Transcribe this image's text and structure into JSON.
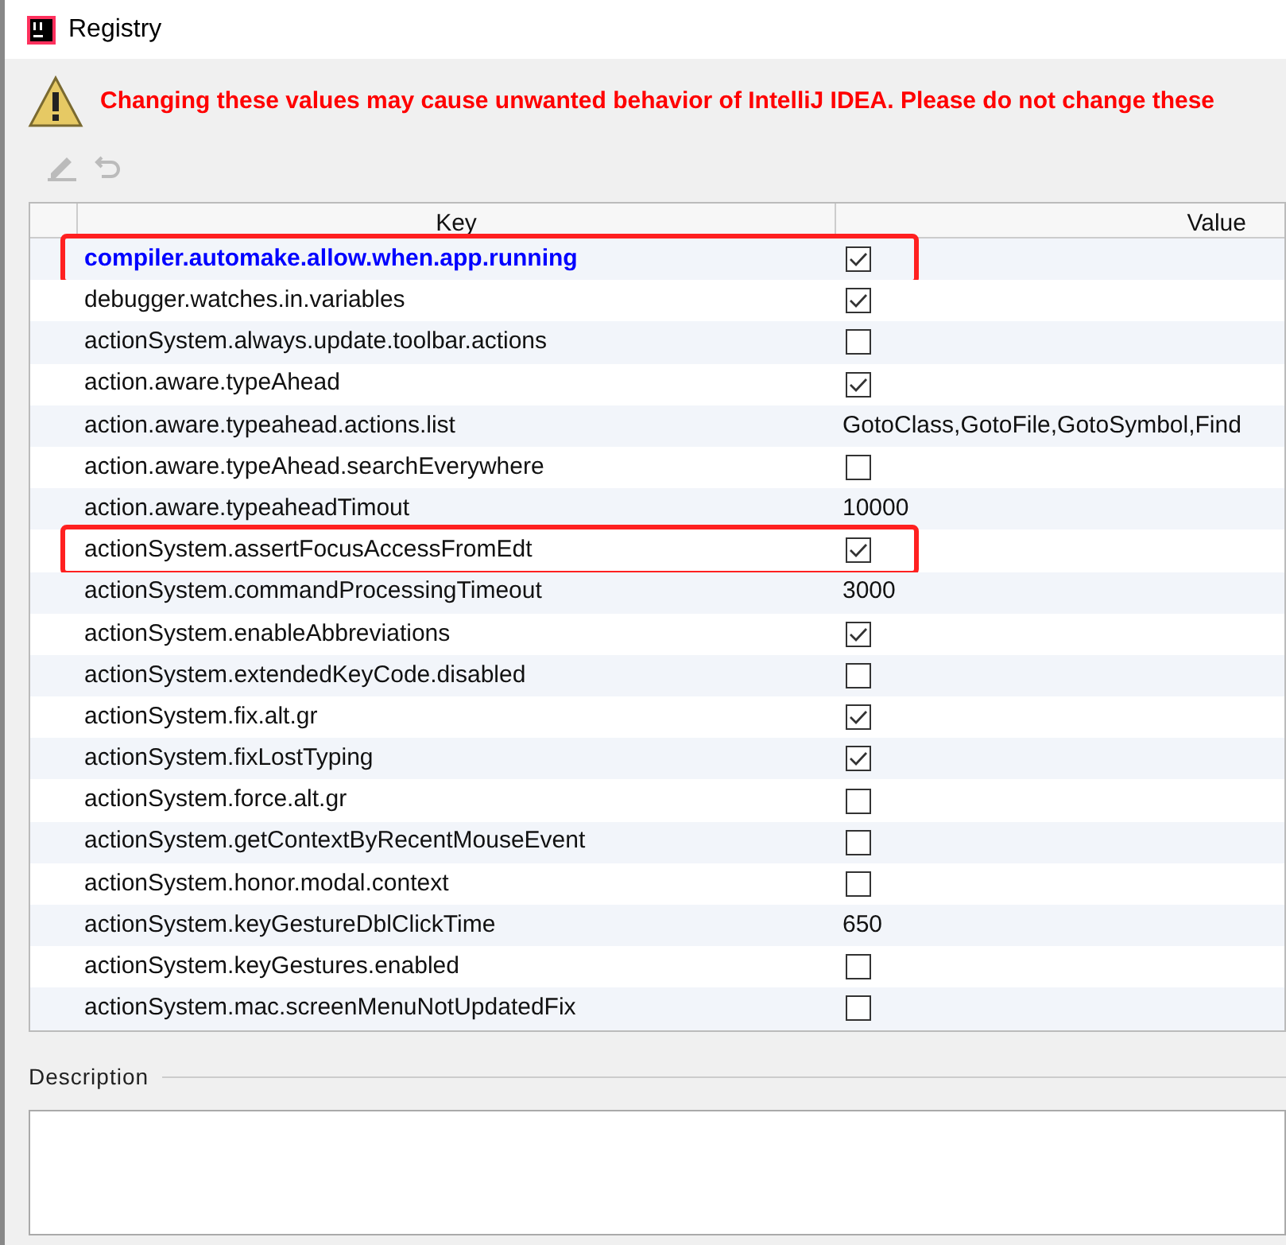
{
  "window": {
    "title": "Registry"
  },
  "warning": "Changing these values may cause unwanted behavior of IntelliJ IDEA. Please do not change these",
  "table": {
    "columns": [
      "Key",
      "Value"
    ],
    "rows": [
      {
        "key": "compiler.automake.allow.when.app.running",
        "kind": "checkbox",
        "checked": true,
        "modified": true,
        "highlighted": true
      },
      {
        "key": "debugger.watches.in.variables",
        "kind": "checkbox",
        "checked": true,
        "modified": false,
        "highlighted": false
      },
      {
        "key": "actionSystem.always.update.toolbar.actions",
        "kind": "checkbox",
        "checked": false,
        "modified": false,
        "highlighted": false
      },
      {
        "key": "action.aware.typeAhead",
        "kind": "checkbox",
        "checked": true,
        "modified": false,
        "highlighted": false
      },
      {
        "key": "action.aware.typeahead.actions.list",
        "kind": "text",
        "value": "GotoClass,GotoFile,GotoSymbol,Find",
        "modified": false,
        "highlighted": false
      },
      {
        "key": "action.aware.typeAhead.searchEverywhere",
        "kind": "checkbox",
        "checked": false,
        "modified": false,
        "highlighted": false
      },
      {
        "key": "action.aware.typeaheadTimout",
        "kind": "text",
        "value": "10000",
        "modified": false,
        "highlighted": false
      },
      {
        "key": "actionSystem.assertFocusAccessFromEdt",
        "kind": "checkbox",
        "checked": true,
        "modified": false,
        "highlighted": true
      },
      {
        "key": "actionSystem.commandProcessingTimeout",
        "kind": "text",
        "value": "3000",
        "modified": false,
        "highlighted": false
      },
      {
        "key": "actionSystem.enableAbbreviations",
        "kind": "checkbox",
        "checked": true,
        "modified": false,
        "highlighted": false
      },
      {
        "key": "actionSystem.extendedKeyCode.disabled",
        "kind": "checkbox",
        "checked": false,
        "modified": false,
        "highlighted": false
      },
      {
        "key": "actionSystem.fix.alt.gr",
        "kind": "checkbox",
        "checked": true,
        "modified": false,
        "highlighted": false
      },
      {
        "key": "actionSystem.fixLostTyping",
        "kind": "checkbox",
        "checked": true,
        "modified": false,
        "highlighted": false
      },
      {
        "key": "actionSystem.force.alt.gr",
        "kind": "checkbox",
        "checked": false,
        "modified": false,
        "highlighted": false
      },
      {
        "key": "actionSystem.getContextByRecentMouseEvent",
        "kind": "checkbox",
        "checked": false,
        "modified": false,
        "highlighted": false
      },
      {
        "key": "actionSystem.honor.modal.context",
        "kind": "checkbox",
        "checked": false,
        "modified": false,
        "highlighted": false
      },
      {
        "key": "actionSystem.keyGestureDblClickTime",
        "kind": "text",
        "value": "650",
        "modified": false,
        "highlighted": false
      },
      {
        "key": "actionSystem.keyGestures.enabled",
        "kind": "checkbox",
        "checked": false,
        "modified": false,
        "highlighted": false
      },
      {
        "key": "actionSystem.mac.screenMenuNotUpdatedFix",
        "kind": "checkbox",
        "checked": false,
        "modified": false,
        "highlighted": false
      }
    ]
  },
  "description": {
    "label": "Description"
  }
}
